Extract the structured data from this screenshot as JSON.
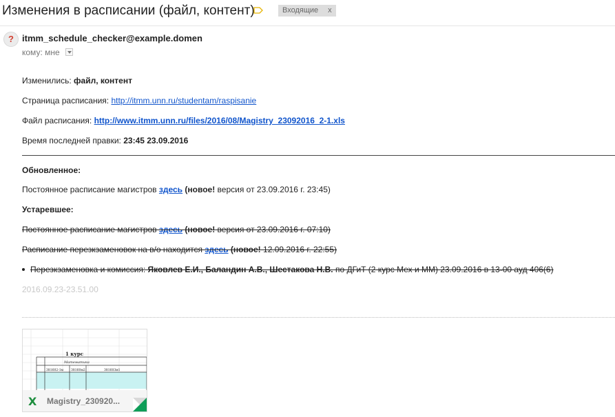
{
  "subject": "Изменения в расписании (файл, контент)",
  "inbox_label": "Входящие",
  "inbox_close": "x",
  "sender": {
    "avatar_glyph": "?",
    "email": "itmm_schedule_checker@example.domen",
    "to_label": "кому:",
    "to_value": "мне"
  },
  "body": {
    "changed_label": "Изменились:",
    "changed_value": "файл, контент",
    "page_label": "Страница расписания:",
    "page_link": "http://itmm.unn.ru/studentam/raspisanie",
    "file_label": "Файл расписания:",
    "file_link": "http://www.itmm.unn.ru/files/2016/08/Magistry_23092016_2-1.xls",
    "edit_label": "Время последней правки:",
    "edit_value": "23:45 23.09.2016",
    "updated_heading": "Обновленное:",
    "updated_line": {
      "prefix": "Постоянное расписание магистров",
      "link": "здесь",
      "new_open": "(",
      "new_word": "новое!",
      "suffix": "версия от 23.09.2016 г. 23:45)"
    },
    "outdated_heading": "Устаревшее:",
    "outdated_line1": {
      "prefix": "Постоянное расписание магистров",
      "link": "здесь",
      "new_open": "(",
      "new_word": "новое!",
      "suffix": "версия от 23.09.2016 г. 07:10)"
    },
    "outdated_line2": {
      "prefix": "Расписание перезкзаменовок на в/о находится",
      "link": "здесь",
      "new_open": "(",
      "new_word": "новое!",
      "suffix": "12.09.2016 г. 22:55)"
    },
    "outdated_bullet": {
      "prefix": "Перезкзаменовка и комиссия:",
      "names": "Яковлев Е.И., Баландин А.В., Шестакова Н.В.",
      "suffix": "по ДГиТ (2 курс Мех и ММ) 23.09.2016 в 13-00 ауд 406(6)"
    },
    "timestamp": "2016.09.23-23.51.00"
  },
  "attachment": {
    "icon": "X",
    "name": "Magistry_230920...",
    "thumb_course": "1 курс",
    "thumb_subject": "Математика",
    "thumb_groups": [
      "381602-1м",
      "38160м2",
      "381603м1"
    ]
  },
  "colors": {
    "link": "#1155cc",
    "label_tag": "#f2c94c",
    "excel_green": "#0f9d58"
  }
}
